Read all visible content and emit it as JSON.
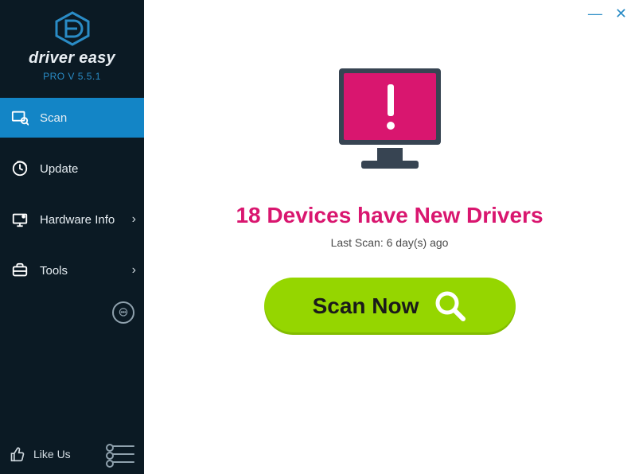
{
  "brand": {
    "name": "driver easy",
    "version_label": "PRO V 5.5.1"
  },
  "sidebar": {
    "items": [
      {
        "label": "Scan"
      },
      {
        "label": "Update"
      },
      {
        "label": "Hardware Info"
      },
      {
        "label": "Tools"
      }
    ],
    "like_label": "Like Us"
  },
  "main": {
    "headline": "18 Devices have New Drivers",
    "last_scan": "Last Scan: 6 day(s) ago",
    "scan_button": "Scan Now"
  },
  "colors": {
    "accent": "#d9166f",
    "primary": "#1385c6",
    "action": "#95d600"
  }
}
